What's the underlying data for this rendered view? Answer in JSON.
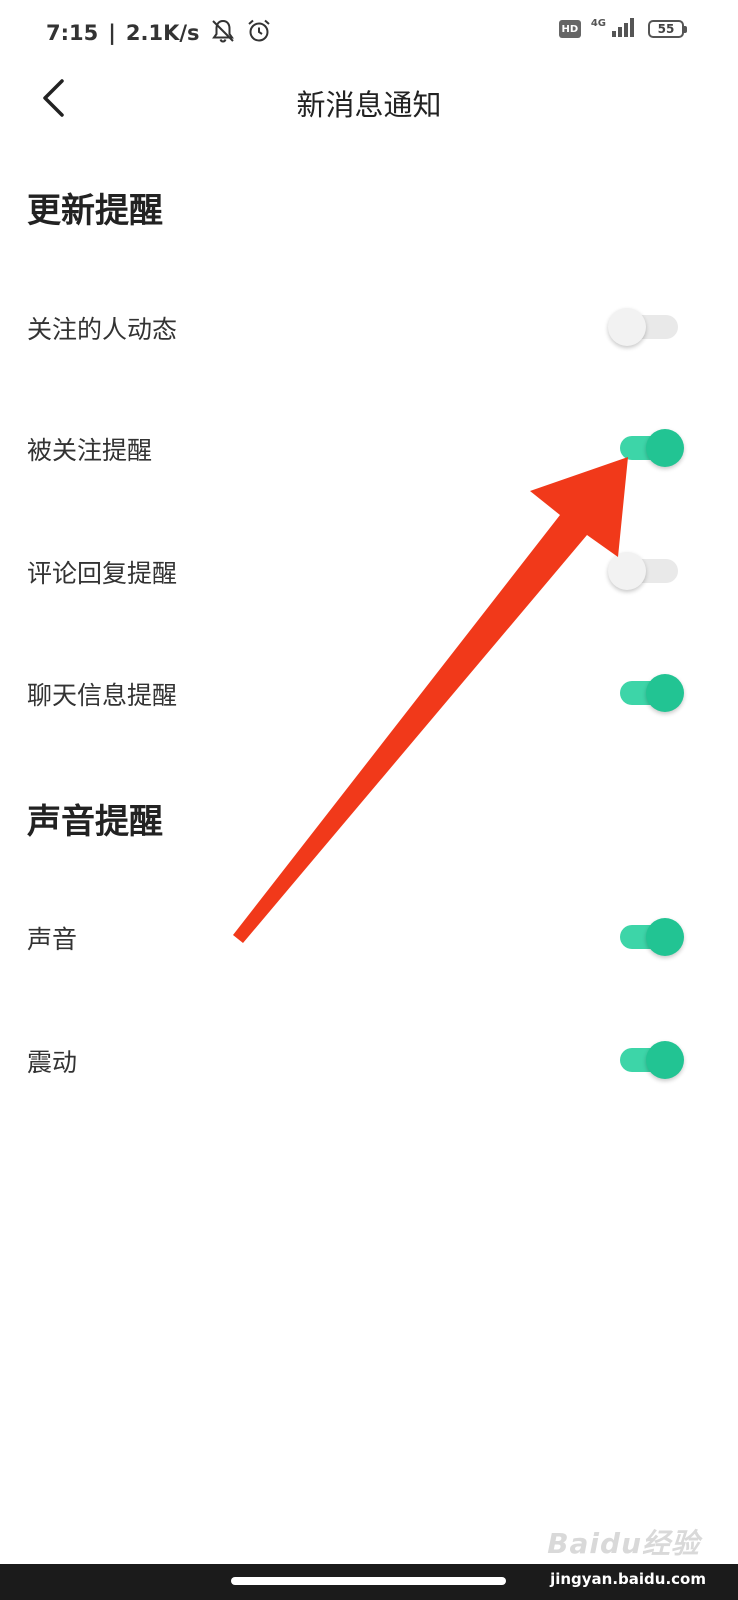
{
  "status_bar": {
    "time": "7:15",
    "separator": "|",
    "net_speed": "2.1K/s",
    "hd_label": "HD",
    "network_type": "4G",
    "battery": "55"
  },
  "header": {
    "title": "新消息通知"
  },
  "sections": [
    {
      "title": "更新提醒",
      "items": [
        {
          "label": "关注的人动态",
          "on": false
        },
        {
          "label": "被关注提醒",
          "on": true
        },
        {
          "label": "评论回复提醒",
          "on": false
        },
        {
          "label": "聊天信息提醒",
          "on": true
        }
      ]
    },
    {
      "title": "声音提醒",
      "items": [
        {
          "label": "声音",
          "on": true
        },
        {
          "label": "震动",
          "on": true
        }
      ]
    }
  ],
  "colors": {
    "switch_on_track": "#3dd5a8",
    "switch_on_thumb": "#22c493",
    "switch_off_track": "#e9e9e9",
    "switch_off_thumb": "#f2f2f2",
    "arrow": "#f1391a"
  },
  "watermark": {
    "text": "Baidu经验",
    "url": "jingyan.baidu.com"
  }
}
